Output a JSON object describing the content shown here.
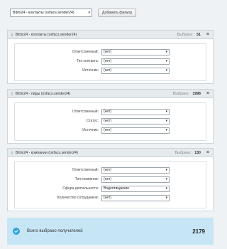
{
  "top": {
    "source_select": "Bitrix24 - контакты (oxfacs.sender24)",
    "add_filter_button": "Добавить фильтр"
  },
  "panels": [
    {
      "title": "Bitrix24 - контакты (oxfacs.sender24)",
      "selected_label": "Выбрано:",
      "count": "51",
      "rows": [
        {
          "label": "Ответственный:",
          "value": "(нет)"
        },
        {
          "label": "Тип контакта:",
          "value": "(нет)"
        },
        {
          "label": "Источник:",
          "value": "(нет)"
        }
      ]
    },
    {
      "title": "Bitrix24 - лиды (oxfacs.sender24)",
      "selected_label": "Выбрано:",
      "count": "1998",
      "rows": [
        {
          "label": "Ответственный:",
          "value": "(нет)"
        },
        {
          "label": "Статус:",
          "value": "(нет)"
        },
        {
          "label": "Источник:",
          "value": "(нет)"
        }
      ]
    },
    {
      "title": "Bitrix24 - компании (oxfacs.sender24)",
      "selected_label": "Выбрано:",
      "count": "130",
      "rows": [
        {
          "label": "Ответственный:",
          "value": "(нет)"
        },
        {
          "label": "Тип компании:",
          "value": "(нет)"
        },
        {
          "label": "Сфера деятельности:",
          "value": "Водоотведение"
        },
        {
          "label": "Количество сотрудников:",
          "value": "(нет)"
        }
      ]
    }
  ],
  "total": {
    "label": "Всего выбрано получателей",
    "count": "2179"
  },
  "icons": {
    "dropdown": "chevron-down-icon",
    "close": "close-icon",
    "drag": "drag-handle-icon",
    "check": "check-circle-icon"
  },
  "colors": {
    "accent": "#2fa3de",
    "total_background": "#c6e6f6",
    "panel_header": "#e5eaed"
  }
}
